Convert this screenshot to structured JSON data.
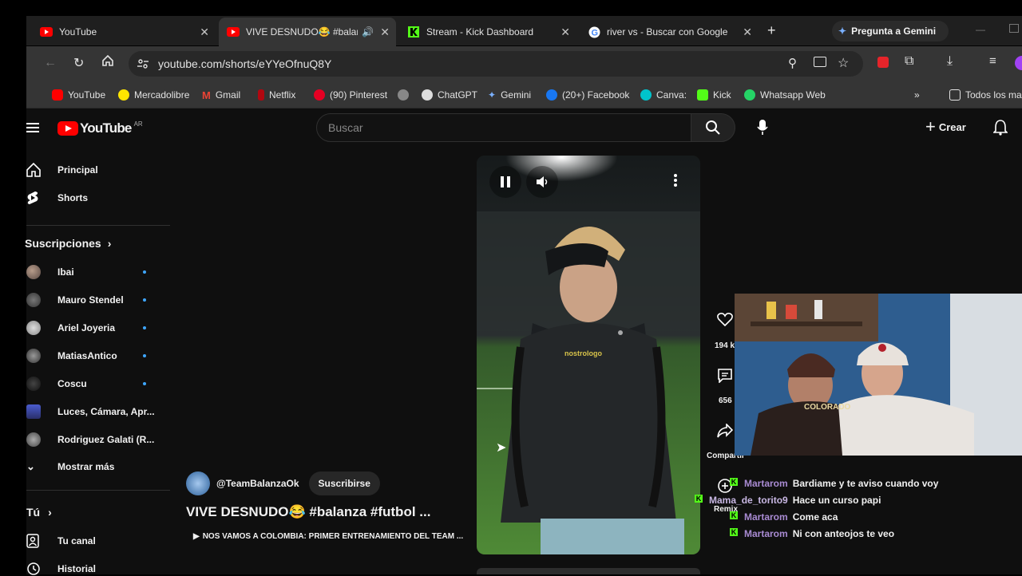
{
  "tabs": [
    {
      "title": "YouTube",
      "active": false
    },
    {
      "title": "VIVE DESNUDO😂 #balan",
      "active": true
    },
    {
      "title": "Stream - Kick Dashboard",
      "active": false
    },
    {
      "title": "river vs - Buscar con Google",
      "active": false
    }
  ],
  "gemini_button": "Pregunta a Gemini",
  "address": "youtube.com/shorts/eYYeOfnuQ8Y",
  "bookmarks": [
    "YouTube",
    "Mercadolibre",
    "Gmail",
    "Netflix",
    "(90) Pinterest",
    "ChatGPT",
    "Gemini",
    "(20+) Facebook",
    "Canva:",
    "Kick",
    "Whatsapp Web"
  ],
  "bookmarks_folder": "Todos los ma",
  "yt": {
    "logo_text": "YouTube",
    "region": "AR",
    "search_placeholder": "Buscar",
    "create_label": "Crear",
    "nav": {
      "home": "Principal",
      "shorts": "Shorts"
    },
    "subscriptions_title": "Suscripciones",
    "subscriptions": [
      "Ibai",
      "Mauro Stendel",
      "Ariel Joyeria",
      "MatiasAntico",
      "Coscu",
      "Luces, Cámara, Apr...",
      "Rodriguez Galati (R..."
    ],
    "show_more": "Mostrar más",
    "you_title": "Tú",
    "your_channel": "Tu canal",
    "history": "Historial",
    "channel": "@TeamBalanzaOk",
    "subscribe": "Suscribirse",
    "short_title": "VIVE DESNUDO😂 #balanza #futbol ...",
    "related": "NOS VAMOS A COLOMBIA: PRIMER ENTRENAMIENTO DEL TEAM ...",
    "likes": "194 k",
    "comments": "656",
    "share": "Compartir",
    "remix": "Remix",
    "shirt_text": "nostrologo"
  },
  "webcam": {
    "cap_text": "COLORADO",
    "chat": [
      {
        "user": "Martarom",
        "msg": "Bardiame y te aviso cuando voy"
      },
      {
        "user": "Mama_de_torito9",
        "msg": "Hace un curso papi"
      },
      {
        "user": "Martarom",
        "msg": "Come aca"
      },
      {
        "user": "Martarom",
        "msg": "Ni con anteojos te veo"
      }
    ]
  },
  "colors": {
    "yt_red": "#ff0000",
    "kick_green": "#53fc18",
    "chat_name": "#a98bd3"
  }
}
